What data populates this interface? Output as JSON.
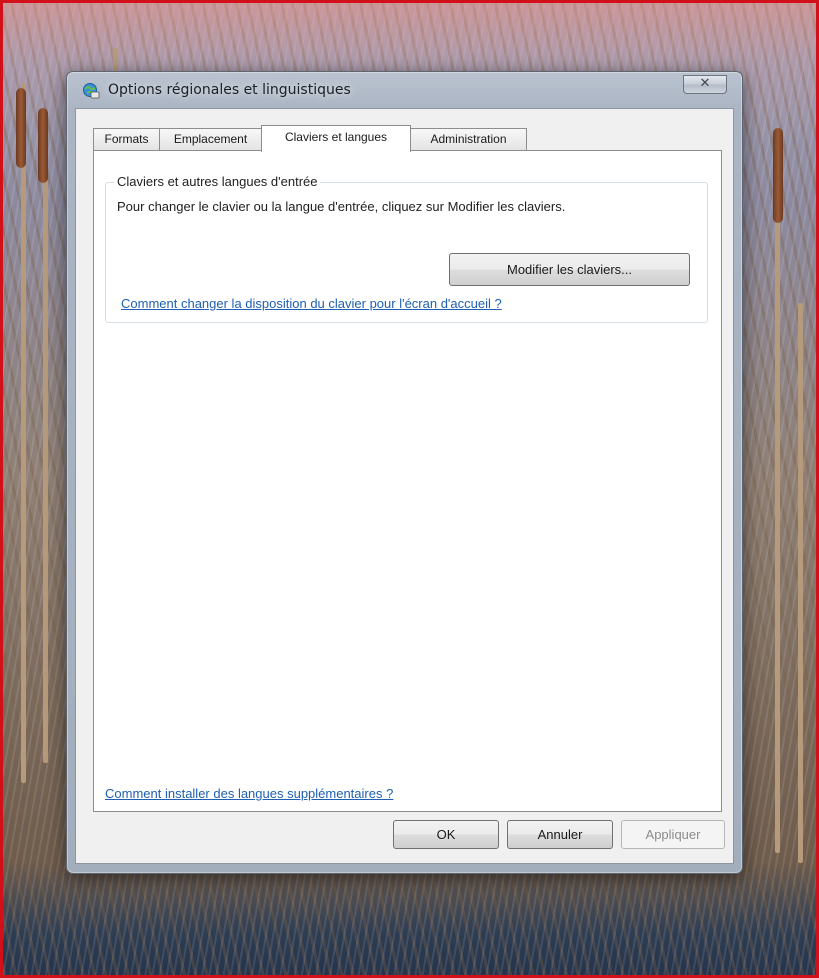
{
  "window": {
    "title": "Options régionales et linguistiques",
    "close_glyph": "✕"
  },
  "tabs": [
    {
      "label": "Formats",
      "active": false
    },
    {
      "label": "Emplacement",
      "active": false
    },
    {
      "label": "Claviers et langues",
      "active": true
    },
    {
      "label": "Administration",
      "active": false
    }
  ],
  "keyboards_group": {
    "legend": "Claviers et autres langues d'entrée",
    "description": "Pour changer le clavier ou la langue d'entrée, cliquez sur Modifier les claviers.",
    "modify_button": "Modifier les claviers...",
    "welcome_screen_link": "Comment changer la disposition du clavier pour l'écran d'accueil ?"
  },
  "install_languages_link": "Comment installer des langues supplémentaires ?",
  "footer": {
    "ok": "OK",
    "cancel": "Annuler",
    "apply": "Appliquer"
  },
  "icons": {
    "title_icon": "globe-keyboard-icon",
    "close_icon": "close-icon"
  },
  "colors": {
    "link": "#1e5fb3",
    "desktop_border": "#d2101a"
  }
}
